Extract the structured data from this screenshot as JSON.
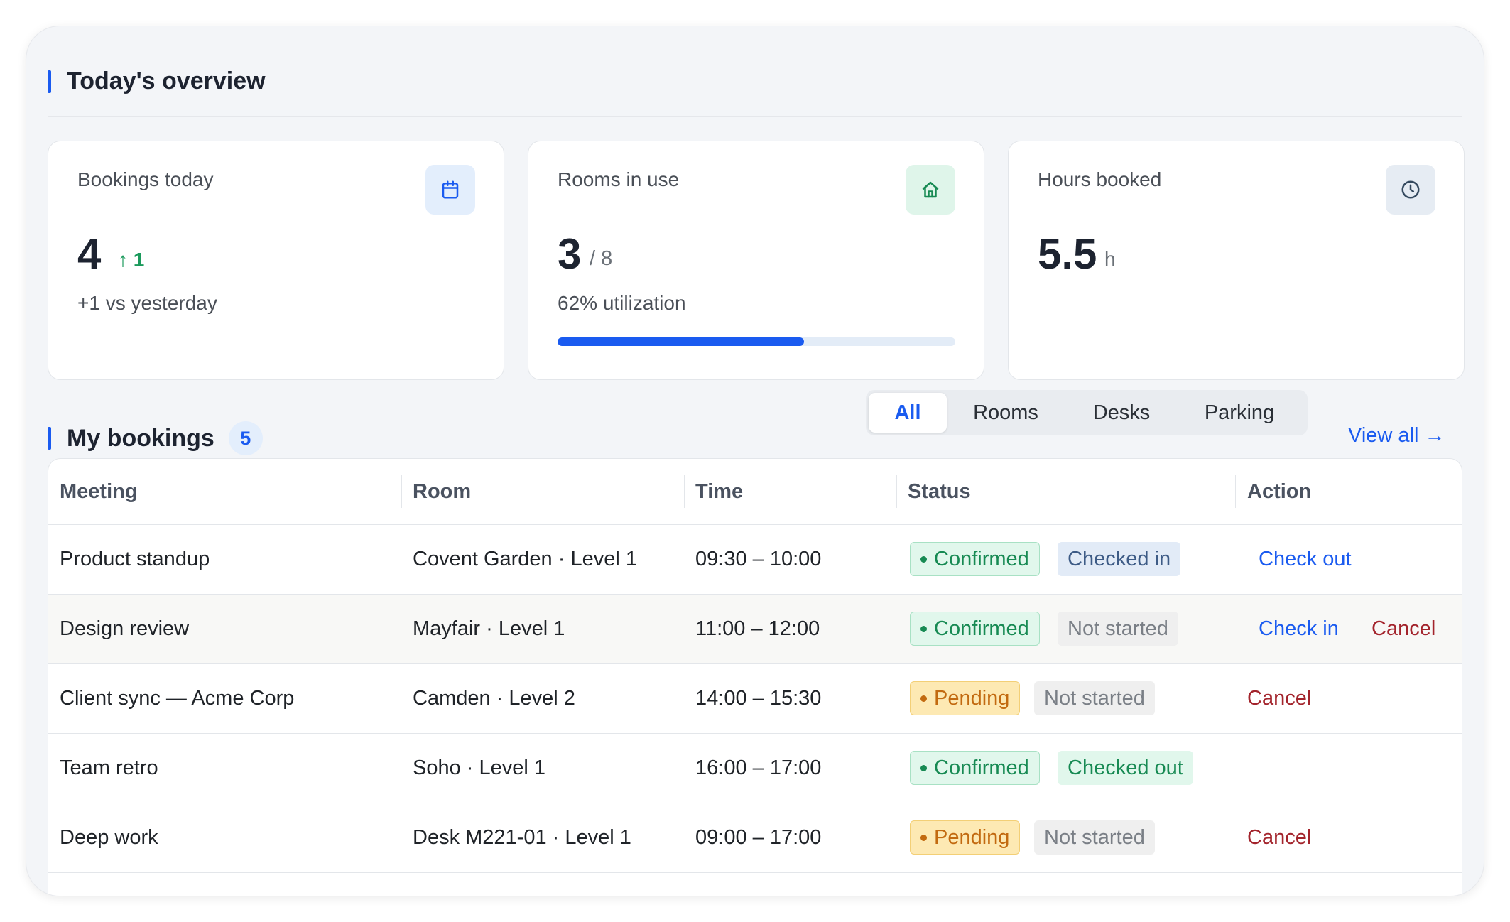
{
  "overview": {
    "title": "Today's overview",
    "cards": [
      {
        "label": "Bookings today",
        "value": "4",
        "trend": "↑ 1",
        "sub": "+1 vs yesterday",
        "icon": "calendar-icon",
        "tile_color": "#e3eefc",
        "icon_color": "#1a5bf0"
      },
      {
        "label": "Rooms in use",
        "value": "3",
        "unit": "/ 8",
        "sub": "62% utilization",
        "progress": 0.62,
        "icon": "home-icon",
        "tile_color": "#dff5ea",
        "icon_color": "#178a53"
      },
      {
        "label": "Hours booked",
        "value": "5.5",
        "unit": "h",
        "icon": "clock-icon",
        "tile_color": "#e6ecf3",
        "icon_color": "#34495e"
      }
    ]
  },
  "bookings": {
    "title": "My bookings",
    "count": "5",
    "tabs": [
      {
        "label": "All",
        "active": true
      },
      {
        "label": "Rooms",
        "active": false
      },
      {
        "label": "Desks",
        "active": false
      },
      {
        "label": "Parking",
        "active": false
      }
    ],
    "view_all": "View all →",
    "columns": [
      "Meeting",
      "Room",
      "Time",
      "Status",
      "Action"
    ],
    "rows": [
      {
        "meeting": "Product standup",
        "room": "Covent Garden · Level 1",
        "time": "09:30 – 10:00",
        "status": "Confirmed",
        "checkin": "Checked in",
        "actions": [
          "Check out"
        ]
      },
      {
        "meeting": "Design review",
        "room": "Mayfair · Level 1",
        "time": "11:00 – 12:00",
        "status": "Confirmed",
        "checkin": "Not started",
        "actions": [
          "Check in",
          "Cancel"
        ]
      },
      {
        "meeting": "Client sync — Acme Corp",
        "room": "Camden · Level 2",
        "time": "14:00 – 15:30",
        "status": "Pending",
        "checkin": "Not started",
        "actions": [
          "Cancel"
        ]
      },
      {
        "meeting": "Team retro",
        "room": "Soho · Level 1",
        "time": "16:00 – 17:00",
        "status": "Confirmed",
        "checkin": "Checked out",
        "actions": []
      },
      {
        "meeting": "Deep work",
        "room": "Desk M221-01 · Level 1",
        "time": "09:00 – 17:00",
        "status": "Pending",
        "checkin": "Not started",
        "actions": [
          "Cancel"
        ]
      }
    ]
  },
  "colors": {
    "accent": "#1a5bf0",
    "success": "#178a53",
    "warning": "#c26a10",
    "danger": "#a3242c"
  }
}
